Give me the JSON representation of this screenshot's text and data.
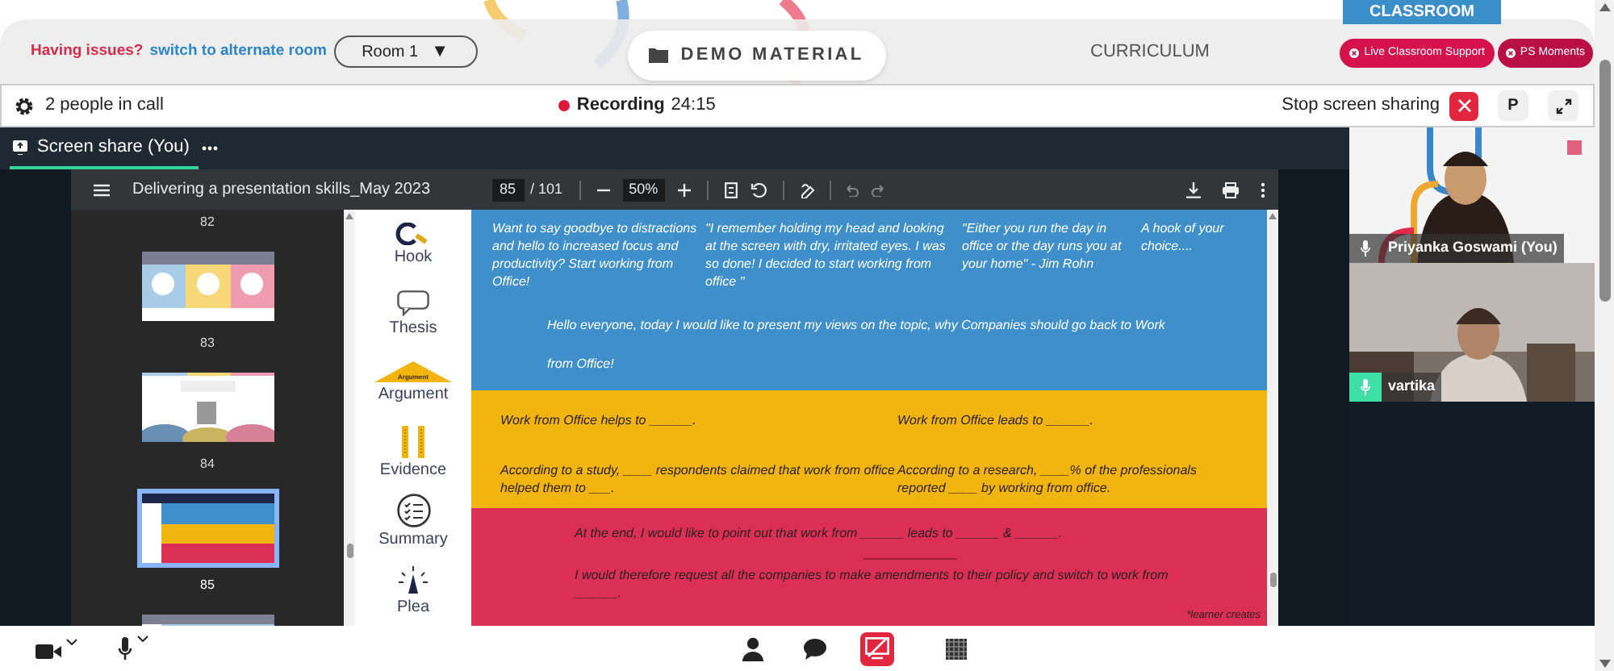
{
  "header": {
    "issue_label": "Having issues?",
    "switch_link": "switch to alternate room",
    "room": "Room 1",
    "room_caret": "▼",
    "demo_material": "DEMO MATERIAL",
    "curriculum": "CURRICULUM",
    "classroom": "CLASSROOM",
    "buttons": [
      "Live Classroom Support",
      "PS Moments"
    ]
  },
  "call_bar": {
    "people": "2 people in call",
    "recording": "Recording",
    "recording_time": "24:15",
    "stop_sharing": "Stop screen sharing",
    "presenter_button": "P"
  },
  "share_tab": {
    "label": "Screen share (You)",
    "selected": true
  },
  "pdf_viewer": {
    "title": "Delivering a presentation skills_May 2023",
    "page": "85",
    "page_total": "/ 101",
    "zoom": "50%",
    "thumbnails": [
      {
        "label": "82",
        "selected": false
      },
      {
        "kind": "panels",
        "label": "83",
        "selected": false
      },
      {
        "kind": "crowd",
        "label": "84",
        "selected": false
      },
      {
        "kind": "table",
        "label": "85",
        "selected": true
      },
      {
        "kind": "sheet",
        "selected": false
      }
    ]
  },
  "slide": {
    "stages": [
      {
        "kind": "hook",
        "label": "Hook"
      },
      {
        "kind": "thesis",
        "label": "Thesis"
      },
      {
        "kind": "argument",
        "label": "Argument",
        "badge": "Argument"
      },
      {
        "kind": "evidence",
        "label": "Evidence"
      },
      {
        "kind": "summary",
        "label": "Summary"
      },
      {
        "kind": "plea",
        "label": "Plea"
      }
    ],
    "bands": [
      {
        "color": "#3e8fca",
        "kind": "deep",
        "rows": [
          {
            "kind": "four",
            "cells": [
              "Want to say goodbye to distractions and hello to increased focus and productivity? Start working from Office!",
              "\"I remember holding my head and looking at the screen with dry, irritated eyes. I was so done! I decided to start working from office \"",
              "\"Either you run the day in office or the day runs you at your home\" - Jim Rohn",
              "A hook of your choice...."
            ]
          },
          {
            "kind": "wide",
            "cells": [
              "Hello everyone, today I would like to present my views on the topic, why Companies should go back to Work from Office!"
            ]
          }
        ]
      },
      {
        "color": "#f2b40f",
        "kind": "bright",
        "rows": [
          {
            "kind": "two",
            "cells": [
              "Work from Office helps to ______.",
              "Work from Office leads to ______."
            ]
          },
          {
            "kind": "two",
            "cells": [
              "According to a study, ____ respondents claimed that work from office helped them to ___.",
              "According to a research, ____% of the professionals reported ____ by working from office."
            ]
          }
        ]
      },
      {
        "color": "#dc2f55",
        "kind": "bright",
        "rows": [
          {
            "kind": "center",
            "cells": [
              "At the end, I would like to point out that work from ______ leads to ______ & ______."
            ]
          },
          {
            "kind": "rule"
          },
          {
            "kind": "center",
            "cells": [
              "I would therefore request all the companies to make amendments to their policy and switch to work from ______."
            ]
          }
        ]
      }
    ],
    "footnote": "*learner creates"
  },
  "participants": [
    {
      "name": "Priyanka Goswami (You)",
      "speaking": false,
      "kind": "presenter"
    },
    {
      "name": "vartika",
      "speaking": true,
      "kind": "room"
    }
  ],
  "bottom_bar": {
    "screen_share_active": true
  }
}
